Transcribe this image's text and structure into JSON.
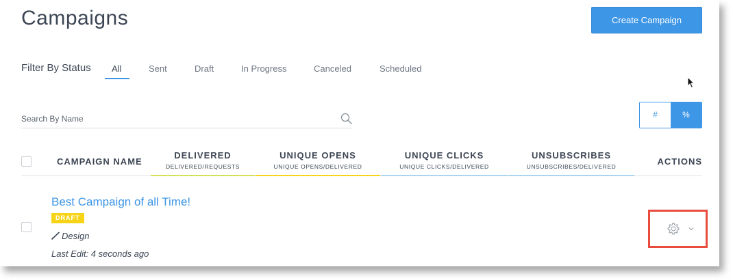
{
  "header": {
    "title": "Campaigns",
    "create_button_label": "Create Campaign"
  },
  "filter": {
    "label": "Filter By Status",
    "tabs": [
      {
        "label": "All",
        "active": true
      },
      {
        "label": "Sent",
        "active": false
      },
      {
        "label": "Draft",
        "active": false
      },
      {
        "label": "In Progress",
        "active": false
      },
      {
        "label": "Canceled",
        "active": false
      },
      {
        "label": "Scheduled",
        "active": false
      }
    ]
  },
  "search": {
    "placeholder": "Search By Name",
    "value": ""
  },
  "display_toggle": {
    "count_label": "#",
    "percent_label": "%",
    "selected": "%"
  },
  "table": {
    "columns": [
      {
        "label": "CAMPAIGN NAME",
        "sub": ""
      },
      {
        "label": "DELIVERED",
        "sub": "DELIVERED/REQUESTS",
        "accent": "#d4e157"
      },
      {
        "label": "UNIQUE OPENS",
        "sub": "UNIQUE OPENS/DELIVERED",
        "accent": "#f7d417"
      },
      {
        "label": "UNIQUE CLICKS",
        "sub": "UNIQUE CLICKS/DELIVERED",
        "accent": "#a9d4f2"
      },
      {
        "label": "UNSUBSCRIBES",
        "sub": "UNSUBSCRIBES/DELIVERED",
        "accent": "#a9d4f2"
      },
      {
        "label": "ACTIONS",
        "sub": ""
      }
    ],
    "rows": [
      {
        "name": "Best Campaign of all Time!",
        "status": "DRAFT",
        "design_label": "Design",
        "last_edit": "Last Edit: 4 seconds ago",
        "actions_icon": "gear-icon"
      }
    ]
  },
  "colors": {
    "primary": "#3d96e6",
    "text": "#3d4654",
    "draft_badge": "#f7d417",
    "highlight": "#e84c3d"
  }
}
